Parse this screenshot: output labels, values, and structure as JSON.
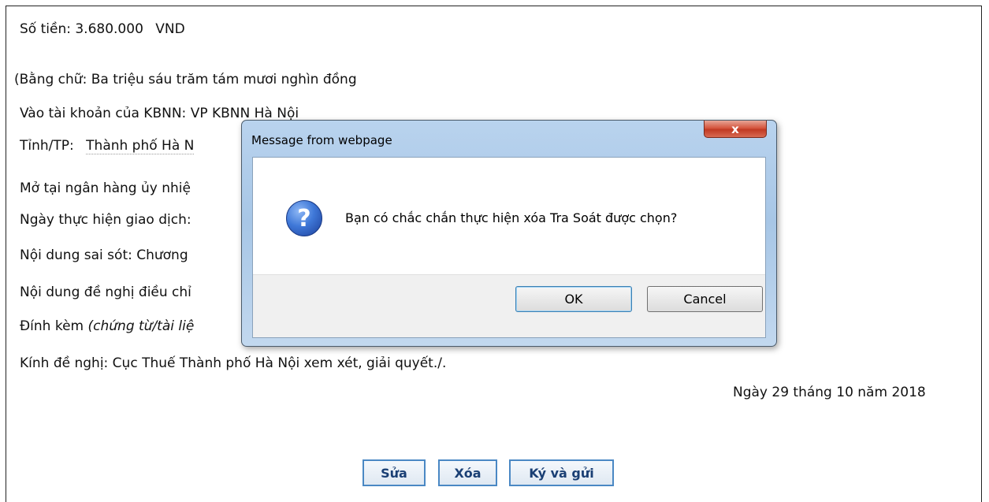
{
  "document": {
    "amount_label": "Số tiền:",
    "amount_value": "3.680.000",
    "amount_currency": "VND",
    "amount_words": "(Bằng chữ: Ba triệu sáu trăm tám mươi nghìn đồng",
    "account_label": "Vào tài khoản của KBNN:",
    "account_value": "VP KBNN Hà Nội",
    "province_label": "Tỉnh/TP:",
    "province_value": "Thành phố Hà N",
    "bank_label": "Mở tại ngân hàng ủy nhiệ",
    "date_label": "Ngày thực hiện giao dịch:",
    "error_content_label": "Nội dung sai sót: Chương",
    "adjust_label": "Nội dung đề nghị điều chỉ",
    "attach_label": "Đính kèm",
    "attach_italic": "(chứng từ/tài liệ",
    "request_text": "Kính đề nghị: Cục Thuế Thành phố Hà Nội xem xét, giải quyết./.",
    "date_text": "Ngày 29 tháng 10 năm 2018"
  },
  "actions": {
    "edit": "Sửa",
    "delete": "Xóa",
    "sign_send": "Ký và gửi"
  },
  "dialog": {
    "title": "Message from webpage",
    "close": "x",
    "message": "Bạn có chắc chắn thực hiện xóa Tra Soát được chọn?",
    "icon_glyph": "?",
    "ok": "OK",
    "cancel": "Cancel"
  }
}
